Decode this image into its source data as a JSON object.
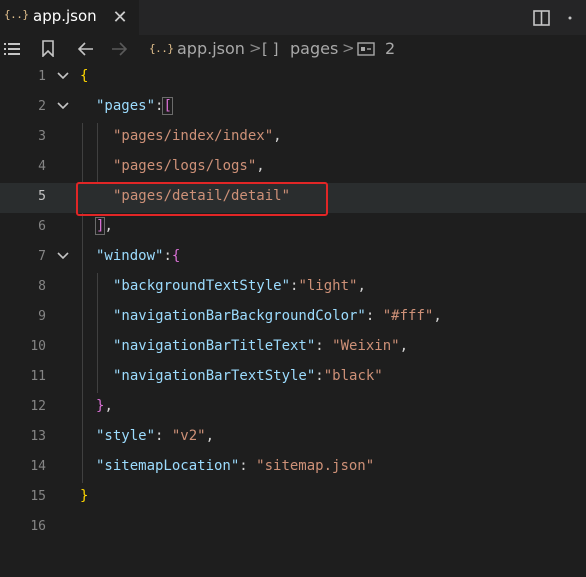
{
  "tab": {
    "icon_text": "{..}",
    "title": "app.json",
    "close_glyph": "✕"
  },
  "breadcrumbs": {
    "file_icon_text": "{..}",
    "file": "app.json",
    "separator": ">",
    "pages_icon_text": "[ ]",
    "pages": "pages",
    "item": "2"
  },
  "colors": {
    "background": "#1e1e1e",
    "tabbar": "#252526",
    "key": "#9cdcfe",
    "string": "#ce9178",
    "brace_level1": "#ffd700",
    "brace_level2": "#da70d6",
    "annotation_box": "#e12626"
  },
  "icons": [
    "json-file-icon",
    "close-icon",
    "split-editor-icon",
    "menu-icon",
    "bookmark-icon",
    "back-arrow-icon",
    "forward-arrow-icon",
    "array-icon",
    "array-item-icon",
    "fold-chevron-icon"
  ],
  "code": {
    "lines": [
      {
        "n": "1",
        "text": "{"
      },
      {
        "n": "2",
        "key": "\"pages\"",
        "after": ":",
        "open": "["
      },
      {
        "n": "3",
        "str": "\"pages/index/index\"",
        "after": ","
      },
      {
        "n": "4",
        "str": "\"pages/logs/logs\"",
        "after": ","
      },
      {
        "n": "5",
        "str": "\"pages/detail/detail\""
      },
      {
        "n": "6",
        "close": "]",
        "after": ","
      },
      {
        "n": "7",
        "key": "\"window\"",
        "after": ":",
        "open": "{"
      },
      {
        "n": "8",
        "key": "\"backgroundTextStyle\"",
        "mid": ":",
        "str": "\"light\"",
        "after": ","
      },
      {
        "n": "9",
        "key": "\"navigationBarBackgroundColor\"",
        "mid": ": ",
        "str": "\"#fff\"",
        "after": ","
      },
      {
        "n": "10",
        "key": "\"navigationBarTitleText\"",
        "mid": ": ",
        "str": "\"Weixin\"",
        "after": ","
      },
      {
        "n": "11",
        "key": "\"navigationBarTextStyle\"",
        "mid": ":",
        "str": "\"black\""
      },
      {
        "n": "12",
        "close": "}",
        "after": ","
      },
      {
        "n": "13",
        "key": "\"style\"",
        "mid": ": ",
        "str": "\"v2\"",
        "after": ","
      },
      {
        "n": "14",
        "key": "\"sitemapLocation\"",
        "mid": ": ",
        "str": "\"sitemap.json\""
      },
      {
        "n": "15",
        "text": "}"
      },
      {
        "n": "16"
      }
    ]
  }
}
